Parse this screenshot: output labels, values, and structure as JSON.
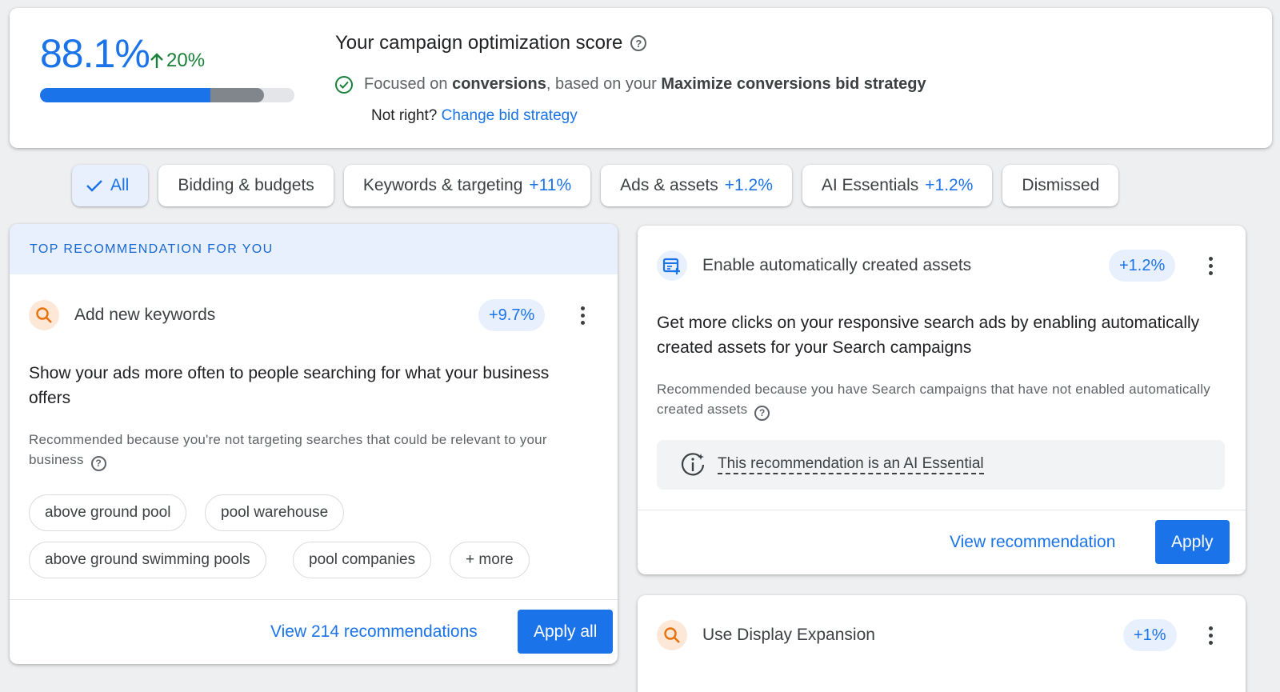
{
  "score": {
    "value": "88.1%",
    "delta": "20%",
    "current_fraction": 0.67,
    "potential_fraction": 0.88,
    "title": "Your campaign optimization score",
    "focus_prefix": "Focused on",
    "focus_bold_1": "conversions",
    "focus_middle": ", based on your",
    "focus_bold_2": "Maximize conversions bid strategy",
    "not_right": "Not right?",
    "change_link": "Change bid strategy"
  },
  "filters": [
    {
      "label": "All",
      "uplift": ""
    },
    {
      "label": "Bidding & budgets",
      "uplift": ""
    },
    {
      "label": "Keywords & targeting",
      "uplift": "+11%"
    },
    {
      "label": "Ads & assets",
      "uplift": "+1.2%"
    },
    {
      "label": "AI Essentials",
      "uplift": "+1.2%"
    },
    {
      "label": "Dismissed",
      "uplift": ""
    }
  ],
  "top_rec": {
    "banner": "TOP RECOMMENDATION FOR YOU",
    "title": "Add new keywords",
    "uplift": "+9.7%",
    "description": "Show your ads more often to people searching for what your business offers",
    "reason": "Recommended because you're not targeting searches that could be relevant to your business",
    "keywords": [
      "above ground pool",
      "pool warehouse",
      "above ground swimming pools",
      "pool companies"
    ],
    "more": "+ more",
    "view_link": "View 214 recommendations",
    "apply_button": "Apply all"
  },
  "auto_rec": {
    "title": "Enable automatically created assets",
    "uplift": "+1.2%",
    "description": "Get more clicks on your responsive search ads by enabling automatically created assets for your Search campaigns",
    "reason": "Recommended because you have Search campaigns that have not enabled automatically created assets",
    "ai_note": "This recommendation is an AI Essential",
    "view_link": "View recommendation",
    "apply_button": "Apply"
  },
  "display_rec": {
    "title": "Use Display Expansion",
    "uplift": "+1%"
  },
  "colors": {
    "accent": "#1a73e8",
    "positive": "#188038",
    "keyword_icon_bg": "#fde8d7",
    "keyword_icon": "#e8710a"
  }
}
